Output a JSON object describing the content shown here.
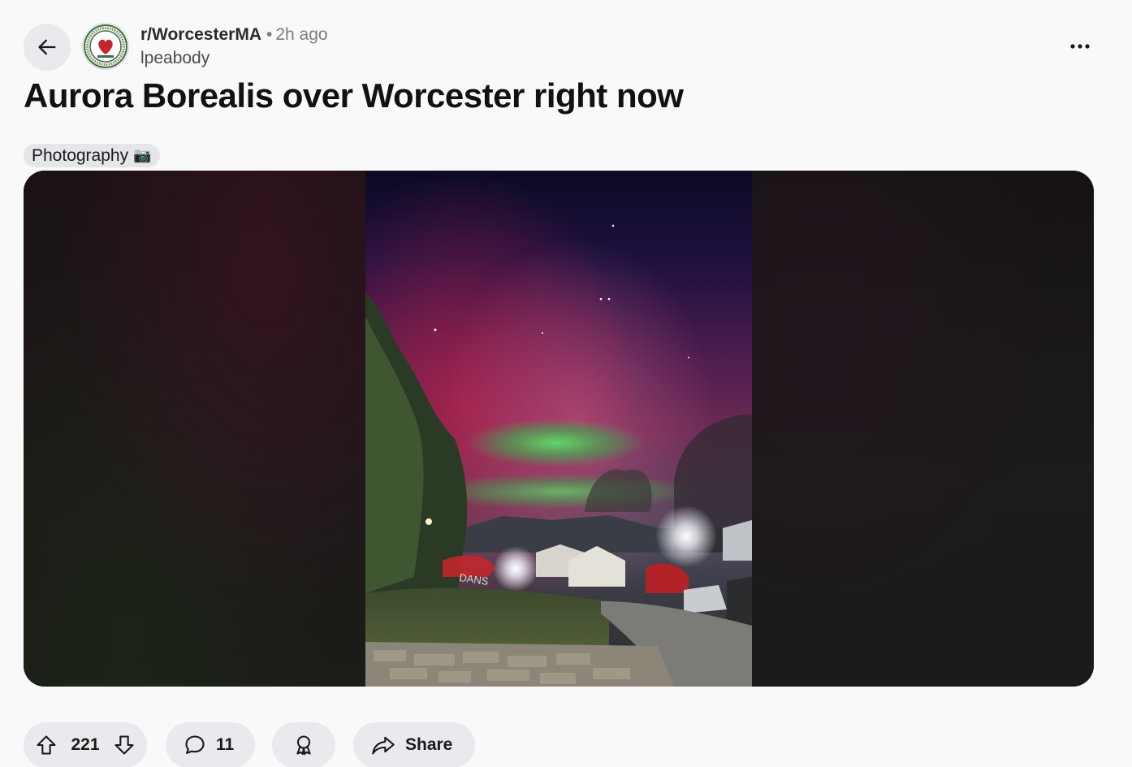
{
  "post": {
    "subreddit": "r/WorcesterMA",
    "separator": "•",
    "time_ago": "2h ago",
    "author": "lpeabody",
    "title": "Aurora Borealis over Worcester right now",
    "flair": "Photography",
    "flair_emoji": "📷"
  },
  "actions": {
    "upvotes": "221",
    "comments": "11",
    "share_label": "Share"
  },
  "icons": {
    "back": "arrow-left-icon",
    "more": "ellipsis-icon",
    "upvote": "upvote-icon",
    "downvote": "downvote-icon",
    "comment": "comment-icon",
    "award": "award-icon",
    "share": "share-icon"
  },
  "colors": {
    "background": "#f9f9f9",
    "pill": "#e8eaed",
    "flair": "#e4e6e9"
  }
}
